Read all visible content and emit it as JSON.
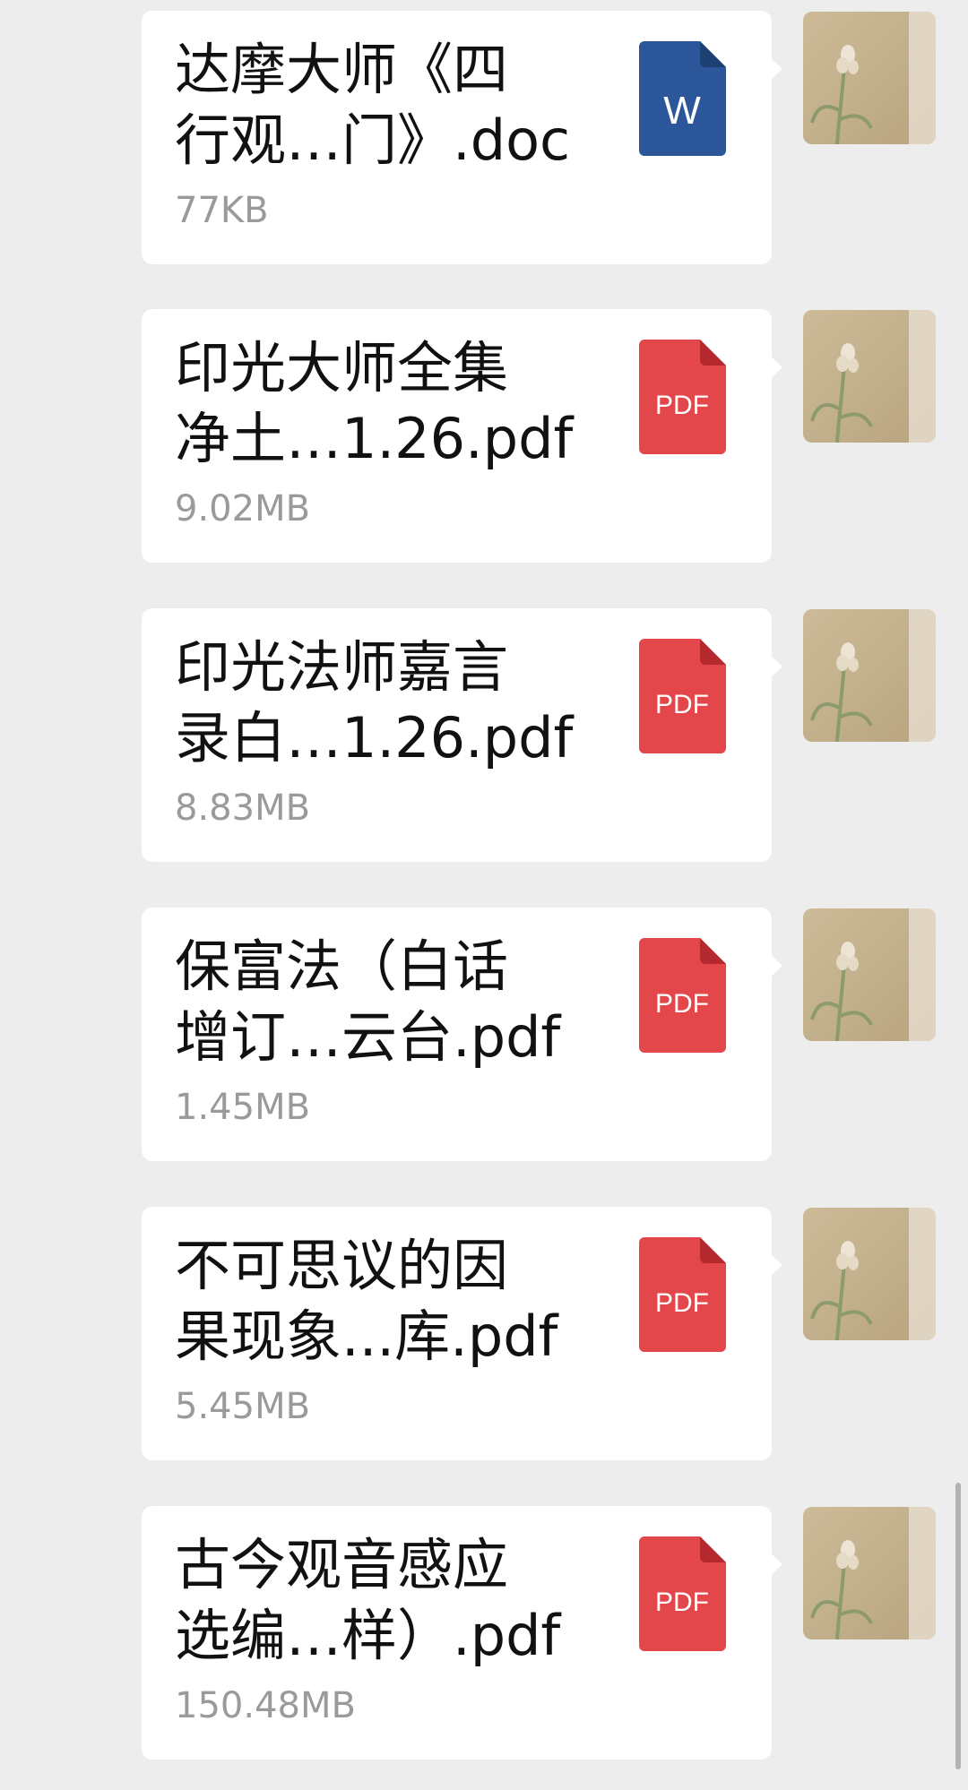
{
  "messages": [
    {
      "file_name": "达摩大师《四\n行观…门》.doc",
      "file_size": "77KB",
      "file_type": "doc",
      "icon_label": "W",
      "icon_color": "#2b579a"
    },
    {
      "file_name": "印光大师全集\n净土…1.26.pdf",
      "file_size": "9.02MB",
      "file_type": "pdf",
      "icon_label": "PDF",
      "icon_color": "#e3464b"
    },
    {
      "file_name": "印光法师嘉言\n录白…1.26.pdf",
      "file_size": "8.83MB",
      "file_type": "pdf",
      "icon_label": "PDF",
      "icon_color": "#e3464b"
    },
    {
      "file_name": "保富法（白话\n增订…云台.pdf",
      "file_size": "1.45MB",
      "file_type": "pdf",
      "icon_label": "PDF",
      "icon_color": "#e3464b"
    },
    {
      "file_name": "不可思议的因\n果现象...库.pdf",
      "file_size": "5.45MB",
      "file_type": "pdf",
      "icon_label": "PDF",
      "icon_color": "#e3464b"
    },
    {
      "file_name": "古今观音感应\n选编…样）.pdf",
      "file_size": "150.48MB",
      "file_type": "pdf",
      "icon_label": "PDF",
      "icon_color": "#e3464b"
    }
  ],
  "colors": {
    "background": "#ededed",
    "bubble": "#ffffff",
    "file_size_text": "#9a9a9a"
  },
  "icons": {
    "doc": "word-document-icon",
    "pdf": "pdf-document-icon",
    "avatar": "orchid-avatar"
  }
}
